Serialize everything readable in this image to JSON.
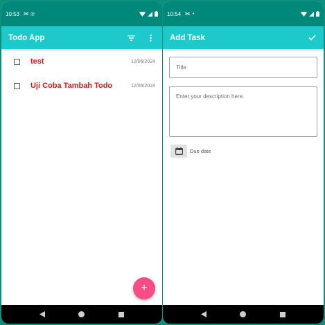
{
  "left": {
    "status": {
      "time": "10:53"
    },
    "appbar": {
      "title": "Todo App",
      "filter_icon": "filter-icon",
      "more_icon": "more-vert-icon"
    },
    "todos": [
      {
        "title": "test",
        "date": "12/06/2024"
      },
      {
        "title": "Uji Coba Tambah Todo",
        "date": "12/06/2024"
      }
    ],
    "fab": {
      "label": "+"
    }
  },
  "right": {
    "status": {
      "time": "10:54"
    },
    "appbar": {
      "title": "Add Task",
      "confirm_icon": "check-icon"
    },
    "form": {
      "title_placeholder": "Title",
      "description_placeholder": "Enter your description here.",
      "due_date_label": "Due date"
    }
  },
  "colors": {
    "appbar": "#1ec9cc",
    "statusbar": "#00897b",
    "fab": "#f74d86",
    "todo_title": "#d41b1b"
  }
}
